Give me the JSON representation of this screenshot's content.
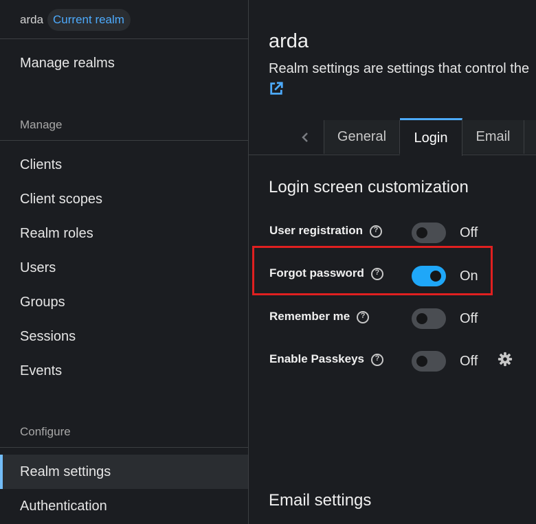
{
  "sidebar": {
    "realm_name": "arda",
    "realm_badge": "Current realm",
    "manage_realms": "Manage realms",
    "manage_section": "Manage",
    "manage_items": [
      "Clients",
      "Client scopes",
      "Realm roles",
      "Users",
      "Groups",
      "Sessions",
      "Events"
    ],
    "configure_section": "Configure",
    "configure_items": [
      "Realm settings",
      "Authentication"
    ]
  },
  "main": {
    "title": "arda",
    "description": "Realm settings are settings that control the",
    "tabs": [
      "General",
      "Login",
      "Email"
    ],
    "active_tab": "Login",
    "login_section_title": "Login screen customization",
    "settings": [
      {
        "label": "User registration",
        "state": "Off"
      },
      {
        "label": "Forgot password",
        "state": "On"
      },
      {
        "label": "Remember me",
        "state": "Off"
      },
      {
        "label": "Enable Passkeys",
        "state": "Off"
      }
    ],
    "email_section_title": "Email settings"
  },
  "colors": {
    "accent": "#1fa7f8",
    "link": "#4daafc",
    "highlight": "#e02020"
  },
  "icons": [
    "external-link-icon",
    "chevron-left-icon",
    "help-icon",
    "gear-icon"
  ]
}
